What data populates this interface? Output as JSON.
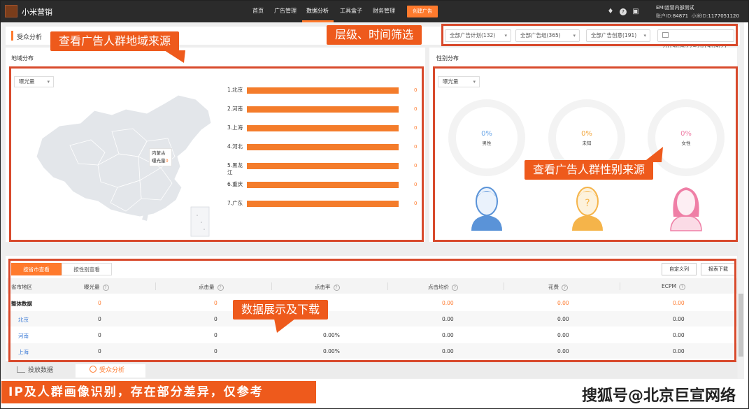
{
  "topnav": {
    "brand": "小米营销",
    "items": [
      "首页",
      "广告管理",
      "数据分析",
      "工具盒子",
      "财务管理"
    ],
    "active_index": 2,
    "create_button": "创建广告",
    "account_name": "EMI运营内部测试",
    "account_id_label": "账户ID:",
    "account_id": "84871",
    "xiaomi_id_label": "小米ID:",
    "xiaomi_id": "1177051120"
  },
  "filter": {
    "title": "受众分析",
    "plan": "全部广告计划(132)",
    "group": "全部广告组(365)",
    "creative": "全部广告创意(191)",
    "date_range": "2019/09/27~2019/09/27"
  },
  "region": {
    "title": "地域分布",
    "metric": "曝光量",
    "tooltip_region": "内蒙古",
    "tooltip_metric": "曝光量",
    "tooltip_value": "0",
    "ranking": [
      {
        "label": "1.北京",
        "value": "0"
      },
      {
        "label": "2.河南",
        "value": "0"
      },
      {
        "label": "3.上海",
        "value": "0"
      },
      {
        "label": "4.河北",
        "value": "0"
      },
      {
        "label": "5.黑龙江",
        "value": "0"
      },
      {
        "label": "6.重庆",
        "value": "0"
      },
      {
        "label": "7.广东",
        "value": "0"
      }
    ]
  },
  "gender": {
    "title": "性别分布",
    "metric": "曝光量",
    "items": [
      {
        "pct": "0%",
        "label": "男性",
        "color": "#6aa6e8"
      },
      {
        "pct": "0%",
        "label": "未知",
        "color": "#f2a53a"
      },
      {
        "pct": "0%",
        "label": "女性",
        "color": "#ef7fa6"
      }
    ]
  },
  "table": {
    "tabs": [
      "按省市查看",
      "按性别查看"
    ],
    "active_tab": 0,
    "custom_columns": "自定义列",
    "download": "报表下载",
    "headers": [
      "省市地区",
      "曝光量",
      "点击量",
      "点击率",
      "点击均价",
      "花费",
      "ECPM"
    ],
    "rows": [
      {
        "name": "整体数据",
        "values": [
          "0",
          "0",
          "",
          "0.00",
          "0.00",
          "0.00"
        ]
      },
      {
        "name": "北京",
        "values": [
          "0",
          "0",
          "",
          "0.00",
          "0.00",
          "0.00"
        ]
      },
      {
        "name": "河南",
        "values": [
          "0",
          "0",
          "0.00%",
          "0.00",
          "0.00",
          "0.00"
        ]
      },
      {
        "name": "上海",
        "values": [
          "0",
          "0",
          "0.00%",
          "0.00",
          "0.00",
          "0.00"
        ]
      }
    ]
  },
  "bottom_tabs": [
    "投放数据",
    "受众分析"
  ],
  "annotations": {
    "region": "查看广告人群地域来源",
    "filter": "层级、时间筛选",
    "gender": "查看广告人群性别来源",
    "table": "数据展示及下载",
    "footer": "IP及人群画像识别，存在部分差异，仅参考",
    "watermark": "搜狐号@北京巨宣网络"
  },
  "colors": {
    "accent": "#ff7a2d",
    "annotation": "#ee5a1c",
    "bar": "#f47c2b",
    "link": "#3a7ad6"
  }
}
